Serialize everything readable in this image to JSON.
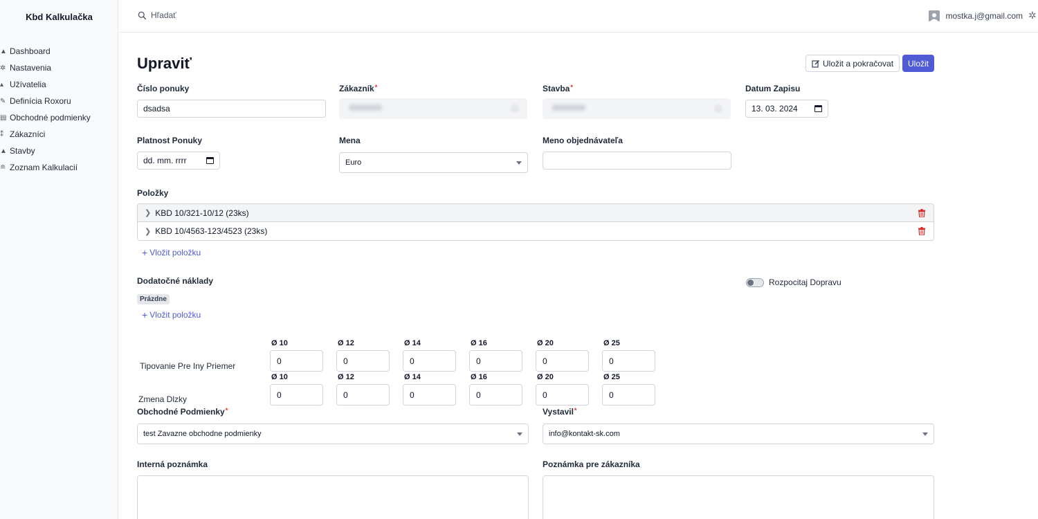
{
  "app": {
    "title": "Kbd Kalkulačka"
  },
  "sidebar": {
    "items": [
      {
        "label": "Dashboard",
        "icon": "home-icon"
      },
      {
        "label": "Nastavenia",
        "icon": "gear-icon"
      },
      {
        "label": "Užívatelia",
        "icon": "user-icon"
      },
      {
        "label": "Definícia Roxoru",
        "icon": "pencil-icon"
      },
      {
        "label": "Obchodné podmienky",
        "icon": "document-icon"
      },
      {
        "label": "Zákazníci",
        "icon": "users-icon"
      },
      {
        "label": "Stavby",
        "icon": "building-icon"
      },
      {
        "label": "Zoznam Kalkulacií",
        "icon": "list-icon"
      }
    ]
  },
  "header": {
    "search_placeholder": "Hľadať",
    "user_email": "mostka.j@gmail.com"
  },
  "page": {
    "title": "Upraviť",
    "save_continue_label": "Uložit a pokračovat",
    "save_label": "Uložit"
  },
  "form": {
    "cislo_ponuky": {
      "label": "Číslo ponuky",
      "value": "dsadsa"
    },
    "zakaznik": {
      "label": "Zákazník"
    },
    "stavba": {
      "label": "Stavba"
    },
    "datum_zapisu": {
      "label": "Datum Zapisu",
      "value": "13. 03. 2024"
    },
    "platnost_ponuky": {
      "label": "Platnost Ponuky",
      "value": "dd. mm. rrrr"
    },
    "mena": {
      "label": "Mena",
      "value": "Euro"
    },
    "meno_objednavatela": {
      "label": "Meno objednávateľa",
      "value": ""
    },
    "required_mark": "*"
  },
  "polozky": {
    "label": "Položky",
    "items": [
      {
        "label": "KBD 10/321-10/12 (23ks)"
      },
      {
        "label": "KBD 10/4563-123/4523 (23ks)"
      }
    ],
    "add_label": "Vložit položku"
  },
  "dodatocne": {
    "label": "Dodatočné náklady",
    "empty_badge": "Prázdne",
    "add_label": "Vložit položku",
    "toggle_label": "Rozpocitaj Dopravu",
    "toggle_on": false
  },
  "diameters": {
    "headers": [
      "Ø 10",
      "Ø 12",
      "Ø 14",
      "Ø 16",
      "Ø 20",
      "Ø 25"
    ],
    "tipovanie": {
      "label": "Tipovanie Pre Iny Priemer",
      "values": [
        "0",
        "0",
        "0",
        "0",
        "0",
        "0"
      ]
    },
    "zmena": {
      "label": "Zmena Dlzky",
      "values": [
        "0",
        "0",
        "0",
        "0",
        "0",
        "0"
      ]
    }
  },
  "obchodne": {
    "label": "Obchodné Podmienky",
    "value": "test Zavazne obchodne podmienky"
  },
  "vystavil": {
    "label": "Vystavil",
    "value": "info@kontakt-sk.com"
  },
  "notes": {
    "interna_label": "Interná poznámka",
    "zakaznik_label": "Poznámka pre zákazníka"
  },
  "colors": {
    "primary": "#4f5bd5",
    "danger": "#dc2626"
  }
}
